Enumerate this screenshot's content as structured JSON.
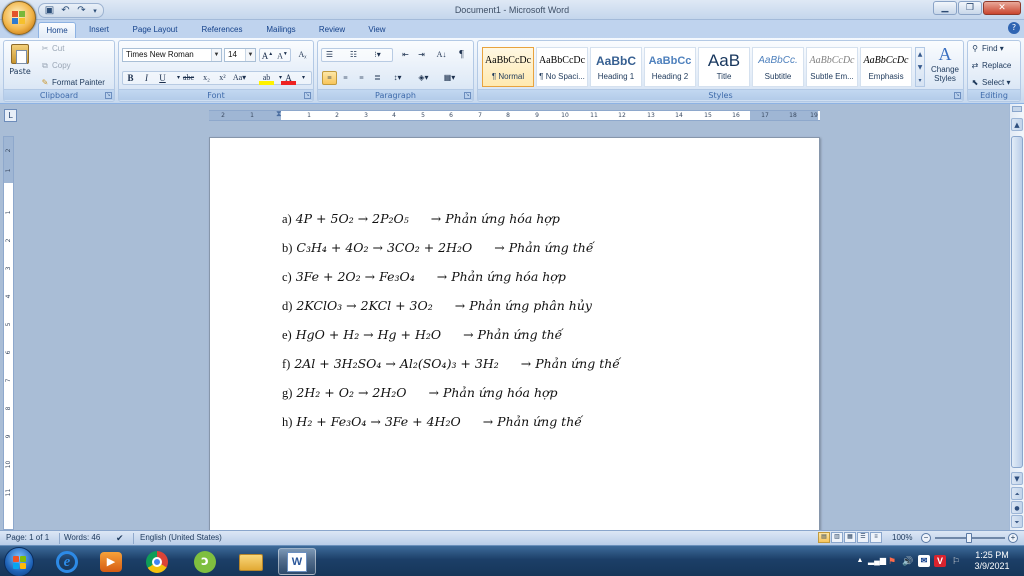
{
  "window": {
    "title": "Document1 - Microsoft Word"
  },
  "tabs": [
    "Home",
    "Insert",
    "Page Layout",
    "References",
    "Mailings",
    "Review",
    "View"
  ],
  "clipboard": {
    "paste": "Paste",
    "cut": "Cut",
    "copy": "Copy",
    "format_painter": "Format Painter",
    "label": "Clipboard"
  },
  "font": {
    "name": "Times New Roman",
    "size": "14",
    "label": "Font"
  },
  "paragraph": {
    "label": "Paragraph"
  },
  "styles": {
    "label": "Styles",
    "items": [
      {
        "sample": "AaBbCcDc",
        "name": "¶ Normal"
      },
      {
        "sample": "AaBbCcDc",
        "name": "¶ No Spaci..."
      },
      {
        "sample": "AaBbC",
        "name": "Heading 1"
      },
      {
        "sample": "AaBbCc",
        "name": "Heading 2"
      },
      {
        "sample": "AaB",
        "name": "Title"
      },
      {
        "sample": "AaBbCc.",
        "name": "Subtitle"
      },
      {
        "sample": "AaBbCcDc",
        "name": "Subtle Em..."
      },
      {
        "sample": "AaBbCcDc",
        "name": "Emphasis"
      }
    ],
    "change_styles": "Change Styles"
  },
  "editing": {
    "find": "Find",
    "replace": "Replace",
    "select": "Select",
    "label": "Editing"
  },
  "ruler": {
    "marks": [
      "2",
      "1",
      "1",
      "2",
      "3",
      "4",
      "5",
      "6",
      "7",
      "8",
      "9",
      "10",
      "11",
      "12",
      "13",
      "14",
      "15",
      "16",
      "17",
      "18",
      "19"
    ]
  },
  "vruler": {
    "marks": [
      "2",
      "1",
      "1",
      "2",
      "3",
      "4",
      "5",
      "6",
      "7",
      "8",
      "9",
      "10",
      "11"
    ]
  },
  "document": {
    "lines": [
      {
        "label": "a)",
        "expr": "4P + 5O₂ → 2P₂O₅",
        "result": "→ Phản ứng hóa hợp"
      },
      {
        "label": "b)",
        "expr": "C₃H₄ + 4O₂ → 3CO₂ + 2H₂O",
        "result": "→ Phản ứng thế"
      },
      {
        "label": "c)",
        "expr": "3Fe + 2O₂ → Fe₃O₄",
        "result": "→ Phản ứng hóa hợp"
      },
      {
        "label": "d)",
        "expr": "2KClO₃ → 2KCl + 3O₂",
        "result": "→ Phản ứng phân hủy"
      },
      {
        "label": "e)",
        "expr": "HgO + H₂ → Hg + H₂O",
        "result": "→ Phản ứng thế"
      },
      {
        "label": "f)",
        "expr": "2Al + 3H₂SO₄ → Al₂(SO₄)₃ + 3H₂",
        "result": "→ Phản ứng thế"
      },
      {
        "label": "g)",
        "expr": "2H₂ + O₂ → 2H₂O",
        "result": "→ Phản ứng hóa hợp"
      },
      {
        "label": "h)",
        "expr": "H₂ + Fe₃O₄ → 3Fe + 4H₂O",
        "result": "→ Phản ứng thế"
      }
    ]
  },
  "status": {
    "page": "Page: 1 of 1",
    "words": "Words: 46",
    "language": "English (United States)",
    "zoom": "100%"
  },
  "clock": {
    "time": "1:25 PM",
    "date": "3/9/2021"
  }
}
